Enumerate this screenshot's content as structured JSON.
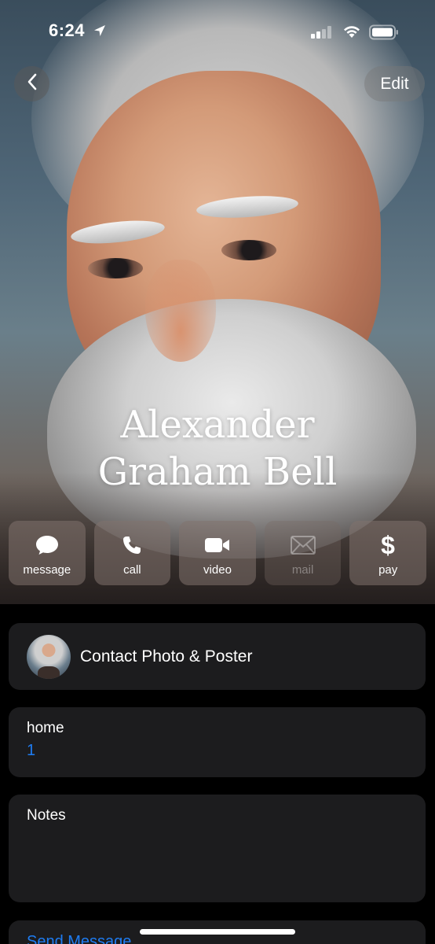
{
  "status_bar": {
    "time": "6:24"
  },
  "nav": {
    "edit_label": "Edit"
  },
  "contact": {
    "first_line": "Alexander",
    "second_line": "Graham Bell"
  },
  "actions": [
    {
      "label": "message",
      "icon": "message-bubble-icon",
      "enabled": true
    },
    {
      "label": "call",
      "icon": "phone-icon",
      "enabled": true
    },
    {
      "label": "video",
      "icon": "video-camera-icon",
      "enabled": true
    },
    {
      "label": "mail",
      "icon": "envelope-icon",
      "enabled": false
    },
    {
      "label": "pay",
      "icon": "dollar-icon",
      "enabled": true
    }
  ],
  "photo_card": {
    "label": "Contact Photo & Poster"
  },
  "phone_card": {
    "label": "home",
    "value": "1"
  },
  "notes_card": {
    "label": "Notes"
  },
  "send_card": {
    "label": "Send Message"
  },
  "colors": {
    "link": "#1e7cf2",
    "card_bg": "#1c1c1e",
    "page_bg": "#000000"
  }
}
